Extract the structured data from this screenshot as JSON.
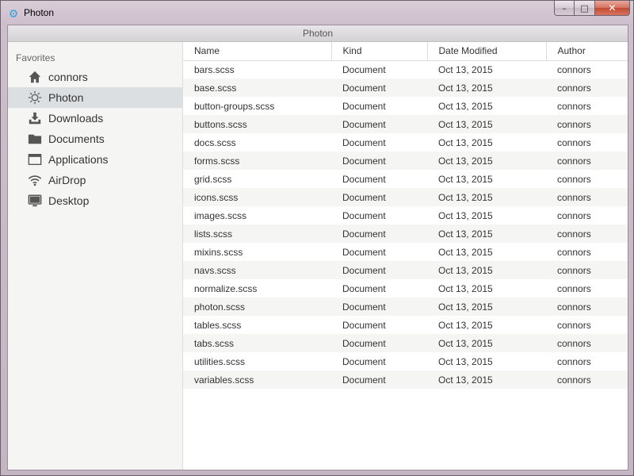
{
  "window": {
    "title": "Photon",
    "controls": {
      "minimize": "–",
      "maximize": "□",
      "close": "✕"
    }
  },
  "toolbar": {
    "title": "Photon"
  },
  "sidebar": {
    "header": "Favorites",
    "items": [
      {
        "label": "connors",
        "icon": "home-icon",
        "active": false
      },
      {
        "label": "Photon",
        "icon": "photon-icon",
        "active": true
      },
      {
        "label": "Downloads",
        "icon": "download-icon",
        "active": false
      },
      {
        "label": "Documents",
        "icon": "folder-icon",
        "active": false
      },
      {
        "label": "Applications",
        "icon": "window-icon",
        "active": false
      },
      {
        "label": "AirDrop",
        "icon": "signal-icon",
        "active": false
      },
      {
        "label": "Desktop",
        "icon": "monitor-icon",
        "active": false
      }
    ]
  },
  "table": {
    "columns": [
      "Name",
      "Kind",
      "Date Modified",
      "Author"
    ],
    "rows": [
      [
        "bars.scss",
        "Document",
        "Oct 13, 2015",
        "connors"
      ],
      [
        "base.scss",
        "Document",
        "Oct 13, 2015",
        "connors"
      ],
      [
        "button-groups.scss",
        "Document",
        "Oct 13, 2015",
        "connors"
      ],
      [
        "buttons.scss",
        "Document",
        "Oct 13, 2015",
        "connors"
      ],
      [
        "docs.scss",
        "Document",
        "Oct 13, 2015",
        "connors"
      ],
      [
        "forms.scss",
        "Document",
        "Oct 13, 2015",
        "connors"
      ],
      [
        "grid.scss",
        "Document",
        "Oct 13, 2015",
        "connors"
      ],
      [
        "icons.scss",
        "Document",
        "Oct 13, 2015",
        "connors"
      ],
      [
        "images.scss",
        "Document",
        "Oct 13, 2015",
        "connors"
      ],
      [
        "lists.scss",
        "Document",
        "Oct 13, 2015",
        "connors"
      ],
      [
        "mixins.scss",
        "Document",
        "Oct 13, 2015",
        "connors"
      ],
      [
        "navs.scss",
        "Document",
        "Oct 13, 2015",
        "connors"
      ],
      [
        "normalize.scss",
        "Document",
        "Oct 13, 2015",
        "connors"
      ],
      [
        "photon.scss",
        "Document",
        "Oct 13, 2015",
        "connors"
      ],
      [
        "tables.scss",
        "Document",
        "Oct 13, 2015",
        "connors"
      ],
      [
        "tabs.scss",
        "Document",
        "Oct 13, 2015",
        "connors"
      ],
      [
        "utilities.scss",
        "Document",
        "Oct 13, 2015",
        "connors"
      ],
      [
        "variables.scss",
        "Document",
        "Oct 13, 2015",
        "connors"
      ]
    ]
  },
  "colors": {
    "app_icon": "#3aa0d8",
    "sidebar_bg": "#f5f5f4",
    "active_item_bg": "#dcdfe1",
    "icon": "#555555"
  }
}
